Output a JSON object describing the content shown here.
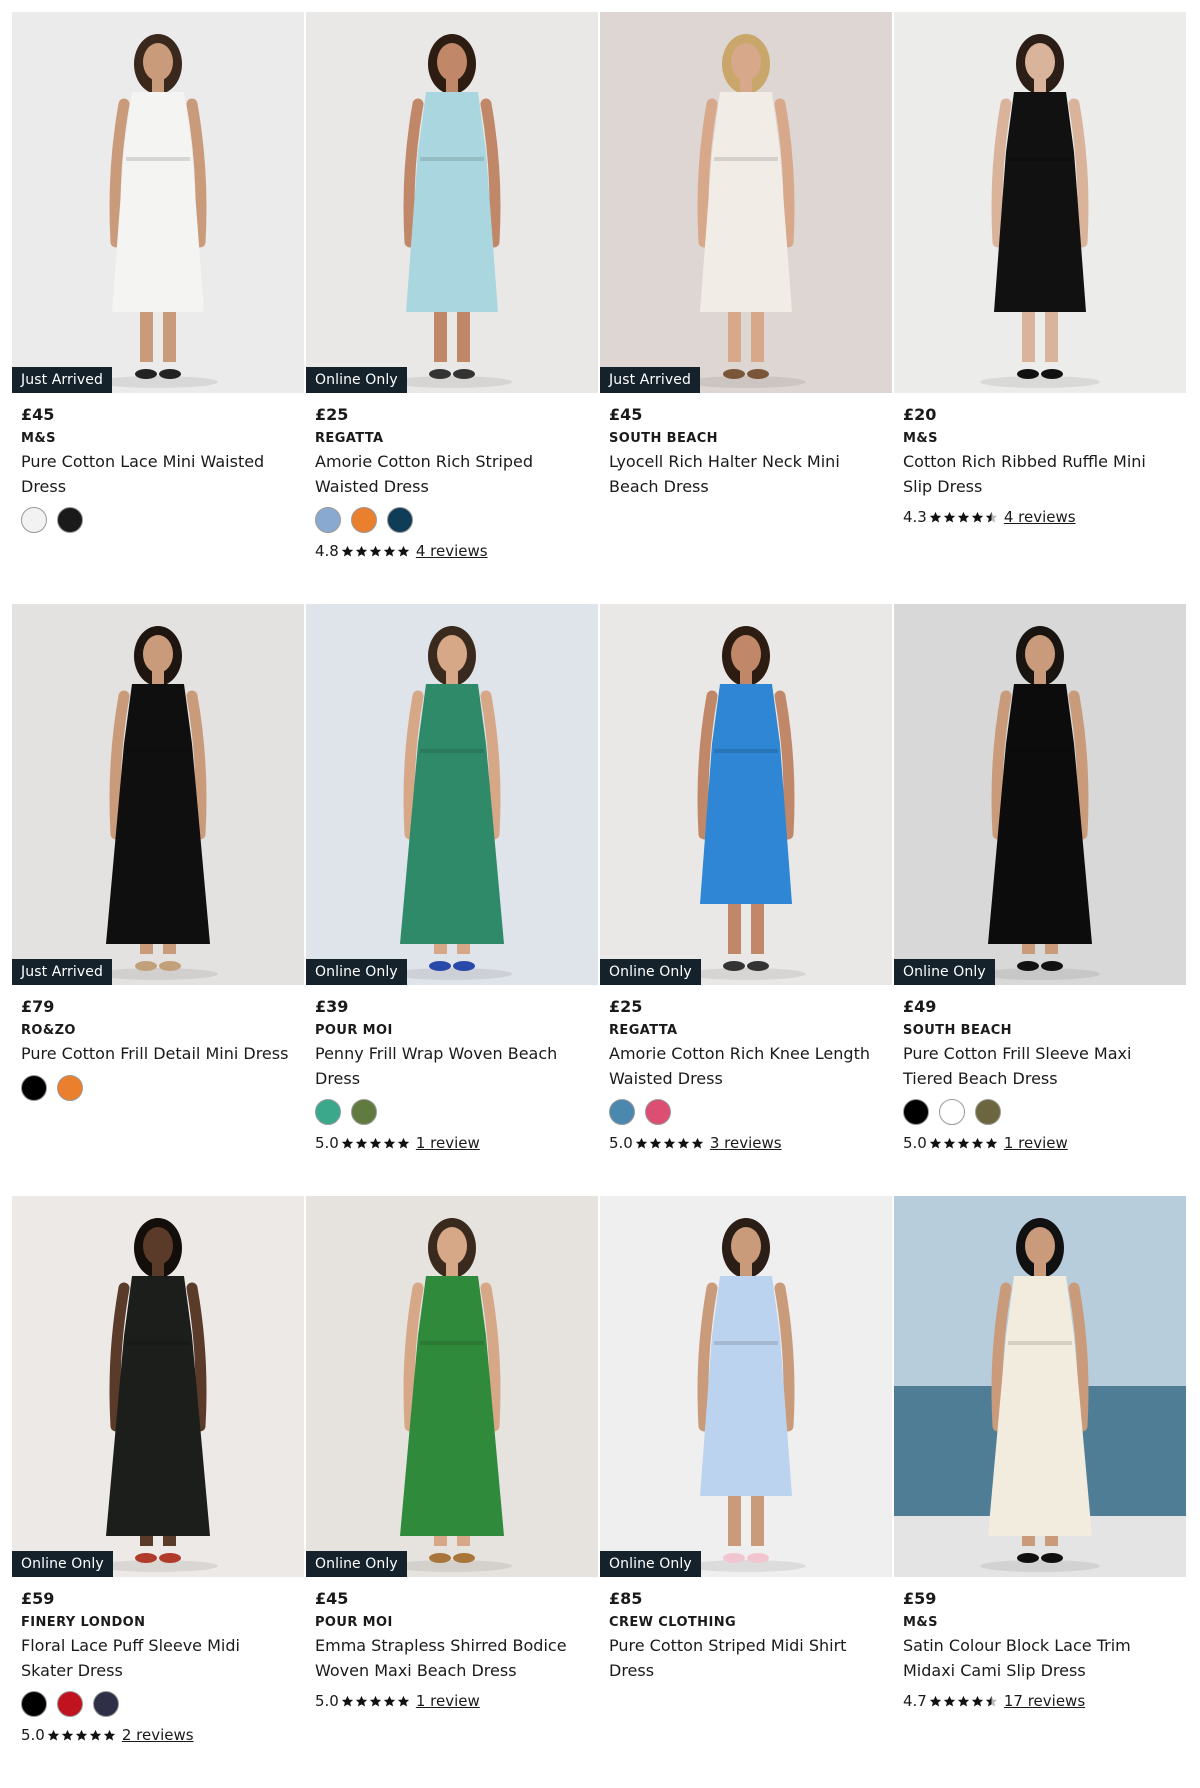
{
  "products": [
    {
      "badge": "Just Arrived",
      "price": "£45",
      "brand": "M&S",
      "name": "Pure Cotton Lace Mini Waisted Dress",
      "swatches": [
        "#f2f2f2",
        "#1a1a1a"
      ],
      "rating": null,
      "reviews": null,
      "scene": {
        "bg": "#ebebeb",
        "dress": "#f4f4f2",
        "skin": "#c99b7a",
        "hair": "#3a281c",
        "accent": "#222"
      }
    },
    {
      "badge": "Online Only",
      "price": "£25",
      "brand": "REGATTA",
      "name": "Amorie Cotton Rich Striped Waisted Dress",
      "swatches": [
        "#8aa9d0",
        "#ea7f2e",
        "#0f3c57"
      ],
      "rating": "4.8",
      "stars": 5,
      "reviews": "4 reviews",
      "scene": {
        "bg": "#e9e8e6",
        "dress": "#a9d6df",
        "skin": "#c08868",
        "hair": "#2c1c12",
        "accent": "#333"
      }
    },
    {
      "badge": "Just Arrived",
      "price": "£45",
      "brand": "SOUTH BEACH",
      "name": "Lyocell Rich Halter Neck Mini Beach Dress",
      "swatches": [],
      "rating": null,
      "reviews": null,
      "scene": {
        "bg": "#ded6d3",
        "dress": "#f1ece6",
        "skin": "#d7a88a",
        "hair": "#c9a66a",
        "accent": "#7a5638"
      }
    },
    {
      "badge": "",
      "price": "£20",
      "brand": "M&S",
      "name": "Cotton Rich Ribbed Ruffle Mini Slip Dress",
      "swatches": [],
      "rating": "4.3",
      "stars": 4.3,
      "reviews": "4 reviews",
      "scene": {
        "bg": "#ececeb",
        "dress": "#111111",
        "skin": "#d9b39a",
        "hair": "#2a1e16",
        "accent": "#111"
      }
    },
    {
      "badge": "Just Arrived",
      "price": "£79",
      "brand": "RO&ZO",
      "name": "Pure Cotton Frill Detail Mini Dress",
      "swatches": [
        "#000000",
        "#ea7f2e"
      ],
      "rating": null,
      "reviews": null,
      "scene": {
        "bg": "#e3e2e1",
        "dress": "#0f0f0f",
        "skin": "#c99b7a",
        "hair": "#1e1510",
        "accent": "#c2a17a"
      }
    },
    {
      "badge": "Online Only",
      "price": "£39",
      "brand": "POUR MOI",
      "name": "Penny Frill Wrap Woven Beach Dress",
      "swatches": [
        "#3aa88b",
        "#607a3f"
      ],
      "rating": "5.0",
      "stars": 5,
      "reviews": "1 review",
      "scene": {
        "bg": "#dfe3ea",
        "dress": "#2f8a6a",
        "skin": "#d6a888",
        "hair": "#3a2a1e",
        "accent": "#2849a8"
      }
    },
    {
      "badge": "Online Only",
      "price": "£25",
      "brand": "REGATTA",
      "name": "Amorie Cotton Rich Knee Length Waisted Dress",
      "swatches": [
        "#4a88b0",
        "#dc4f72"
      ],
      "rating": "5.0",
      "stars": 5,
      "reviews": "3 reviews",
      "scene": {
        "bg": "#e9e8e6",
        "dress": "#2f86d4",
        "skin": "#c08868",
        "hair": "#2c1c12",
        "accent": "#333"
      }
    },
    {
      "badge": "Online Only",
      "price": "£49",
      "brand": "SOUTH BEACH",
      "name": "Pure Cotton Frill Sleeve Maxi Tiered Beach Dress",
      "swatches": [
        "#000000",
        "#ffffff",
        "#6b6640"
      ],
      "rating": "5.0",
      "stars": 5,
      "reviews": "1 review",
      "scene": {
        "bg": "#d8d8d8",
        "dress": "#0c0c0c",
        "skin": "#c99b7a",
        "hair": "#1a1410",
        "accent": "#111"
      }
    },
    {
      "badge": "Online Only",
      "price": "£59",
      "brand": "FINERY LONDON",
      "name": "Floral Lace Puff Sleeve Midi Skater Dress",
      "swatches": [
        "#000000",
        "#c1121f",
        "#2f3047"
      ],
      "rating": "5.0",
      "stars": 5,
      "reviews": "2 reviews",
      "scene": {
        "bg": "#ece9e7",
        "dress": "#1c1e1c",
        "skin": "#5a3a28",
        "hair": "#140e0a",
        "accent": "#b23a2a"
      }
    },
    {
      "badge": "Online Only",
      "price": "£45",
      "brand": "POUR MOI",
      "name": "Emma Strapless Shirred Bodice Woven Maxi Beach Dress",
      "swatches": [],
      "rating": "5.0",
      "stars": 5,
      "reviews": "1 review",
      "scene": {
        "bg": "#e6e3df",
        "dress": "#2f8a3c",
        "skin": "#d6a888",
        "hair": "#3a2a1e",
        "accent": "#a8763a"
      }
    },
    {
      "badge": "Online Only",
      "price": "£85",
      "brand": "CREW CLOTHING",
      "name": "Pure Cotton Striped Midi Shirt Dress",
      "swatches": [],
      "rating": null,
      "reviews": null,
      "scene": {
        "bg": "#efefef",
        "dress": "#bcd3ef",
        "skin": "#c99b7a",
        "hair": "#2a1e16",
        "accent": "#f1c6d0"
      }
    },
    {
      "badge": "",
      "price": "£59",
      "brand": "M&S",
      "name": "Satin Colour Block Lace Trim Midaxi Cami Slip Dress",
      "swatches": [],
      "rating": "4.7",
      "stars": 4.7,
      "reviews": "17 reviews",
      "scene": {
        "bg": "#a9c2d6",
        "dress": "#f2ecdf",
        "skin": "#c99b7a",
        "hair": "#111",
        "accent": "#0f0f0f",
        "sea": true
      }
    }
  ]
}
